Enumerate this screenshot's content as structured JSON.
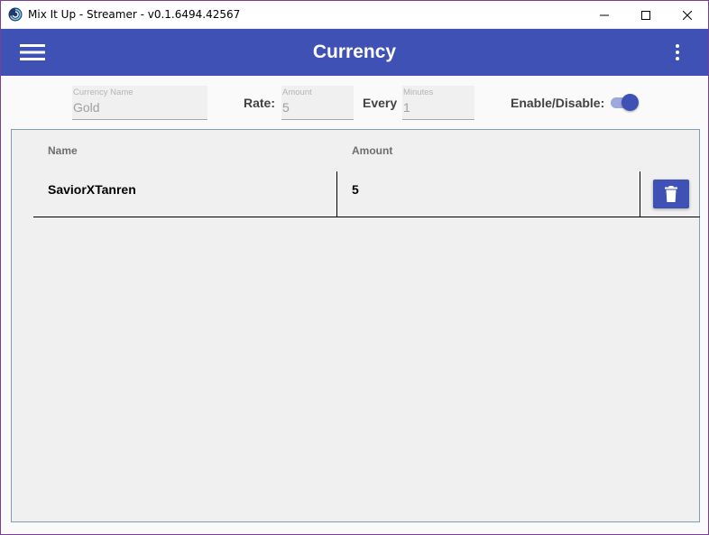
{
  "window": {
    "title": "Mix It Up - Streamer - v0.1.6494.42567",
    "controls": [
      "minimize-icon",
      "maximize-icon",
      "close-icon"
    ]
  },
  "appbar": {
    "title": "Currency",
    "menu_icon": "hamburger-menu-icon",
    "more_icon": "more-vertical-icon",
    "color": "#3f51b5"
  },
  "settings": {
    "currency_name": {
      "label": "Currency Name",
      "value": "Gold"
    },
    "rate_label": "Rate:",
    "amount": {
      "label": "Amount",
      "value": "5"
    },
    "every_label": "Every",
    "minutes": {
      "label": "Minutes",
      "value": "1"
    },
    "enable_label": "Enable/Disable:",
    "enabled": true
  },
  "table": {
    "columns": [
      "Name",
      "Amount"
    ],
    "rows": [
      {
        "name": "SaviorXTanren",
        "amount": "5",
        "action_icon": "trash-icon"
      }
    ]
  }
}
